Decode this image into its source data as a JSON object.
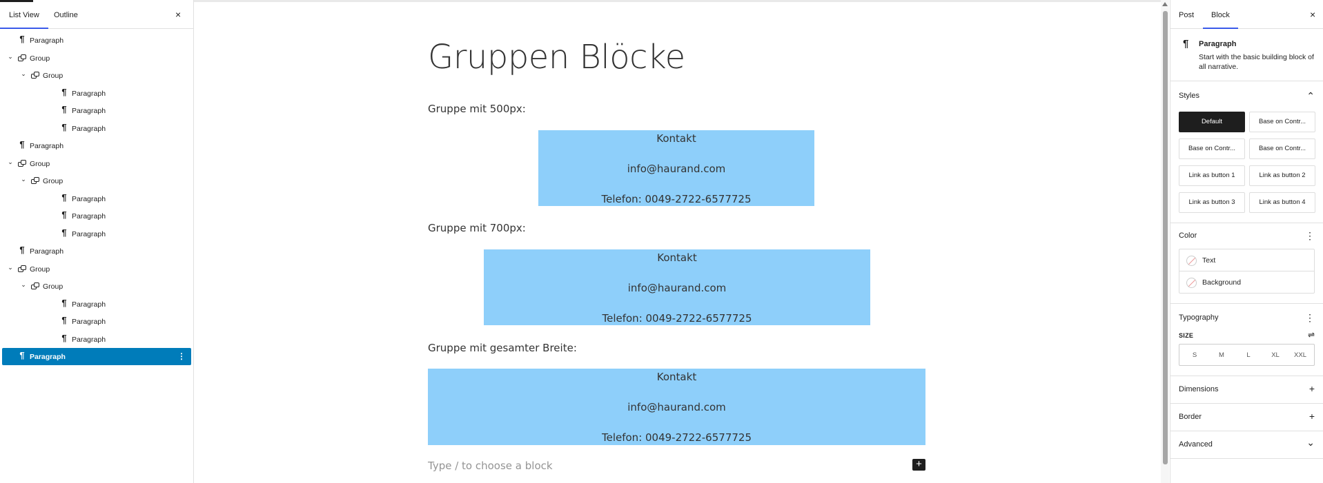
{
  "list_view": {
    "tabs": [
      "List View",
      "Outline"
    ],
    "close": "×",
    "items": [
      {
        "label": "Paragraph",
        "type": "paragraph",
        "depth": 0,
        "expander": ""
      },
      {
        "label": "Group",
        "type": "group",
        "depth": 0,
        "expander": "⌄"
      },
      {
        "label": "Group",
        "type": "group",
        "depth": 1,
        "expander": "⌄"
      },
      {
        "label": "Paragraph",
        "type": "paragraph",
        "depth": 2,
        "expander": ""
      },
      {
        "label": "Paragraph",
        "type": "paragraph",
        "depth": 2,
        "expander": ""
      },
      {
        "label": "Paragraph",
        "type": "paragraph",
        "depth": 2,
        "expander": ""
      },
      {
        "label": "Paragraph",
        "type": "paragraph",
        "depth": 0,
        "expander": ""
      },
      {
        "label": "Group",
        "type": "group",
        "depth": 0,
        "expander": "⌄"
      },
      {
        "label": "Group",
        "type": "group",
        "depth": 1,
        "expander": "⌄"
      },
      {
        "label": "Paragraph",
        "type": "paragraph",
        "depth": 2,
        "expander": ""
      },
      {
        "label": "Paragraph",
        "type": "paragraph",
        "depth": 2,
        "expander": ""
      },
      {
        "label": "Paragraph",
        "type": "paragraph",
        "depth": 2,
        "expander": ""
      },
      {
        "label": "Paragraph",
        "type": "paragraph",
        "depth": 0,
        "expander": ""
      },
      {
        "label": "Group",
        "type": "group",
        "depth": 0,
        "expander": "⌄"
      },
      {
        "label": "Group",
        "type": "group",
        "depth": 1,
        "expander": "⌄"
      },
      {
        "label": "Paragraph",
        "type": "paragraph",
        "depth": 2,
        "expander": ""
      },
      {
        "label": "Paragraph",
        "type": "paragraph",
        "depth": 2,
        "expander": ""
      },
      {
        "label": "Paragraph",
        "type": "paragraph",
        "depth": 2,
        "expander": ""
      },
      {
        "label": "Paragraph",
        "type": "paragraph",
        "depth": 0,
        "expander": "",
        "selected": true
      }
    ],
    "selected_color": "#007cba",
    "options_icon": "⋮"
  },
  "canvas": {
    "title": "Gruppen Blöcke",
    "sections": [
      {
        "heading": "Gruppe mit 500px:",
        "lines": [
          "Kontakt",
          "info@haurand.com",
          "Telefon: 0049-2722-6577725"
        ]
      },
      {
        "heading": "Gruppe mit 700px:",
        "lines": [
          "Kontakt",
          "info@haurand.com",
          "Telefon: 0049-2722-6577725"
        ]
      },
      {
        "heading": "Gruppe mit gesamter Breite:",
        "lines": [
          "Kontakt",
          "info@haurand.com",
          "Telefon: 0049-2722-6577725"
        ]
      }
    ],
    "group_background": "#8ecffa",
    "appender_placeholder": "Type / to choose a block",
    "add_block": "+"
  },
  "inspector": {
    "tabs": [
      "Post",
      "Block"
    ],
    "close": "×",
    "block": {
      "icon": "¶",
      "name": "Paragraph",
      "description": "Start with the basic building block of all narrative."
    },
    "styles": {
      "title": "Styles",
      "toggle": "⌃",
      "options": [
        "Default",
        "Base on Contr...",
        "Base on Contr...",
        "Base on Contr...",
        "Link as button 1",
        "Link as button 2",
        "Link as button 3",
        "Link as button 4"
      ],
      "active_index": 0
    },
    "color": {
      "title": "Color",
      "menu": "⋮",
      "items": [
        "Text",
        "Background"
      ]
    },
    "typography": {
      "title": "Typography",
      "menu": "⋮",
      "size_label": "SIZE",
      "size_settings_icon": "⇌",
      "sizes": [
        "S",
        "M",
        "L",
        "XL",
        "XXL"
      ]
    },
    "panels": [
      {
        "title": "Dimensions",
        "toggle": "+"
      },
      {
        "title": "Border",
        "toggle": "+"
      },
      {
        "title": "Advanced",
        "toggle": "⌄"
      }
    ]
  }
}
